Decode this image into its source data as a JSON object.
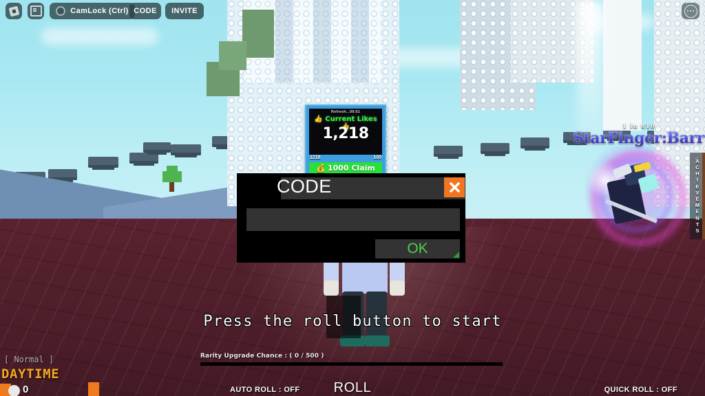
{
  "topbar": {
    "roblox_icon": "roblox-logo-icon",
    "chat_icon": "chat-icon",
    "camlock_label": "CamLock (Ctrl)",
    "code_label": "CODE",
    "invite_label": "INVITE",
    "more_icon": "more-options-icon"
  },
  "likes_board": {
    "refresh_label": "Refresh...09:51",
    "title": "Current Likes",
    "thumbs_icon": "thumbs-up-icon",
    "count": "1,218",
    "progress_min": "1218",
    "progress_max": "100",
    "claim_label": "1000 Claim",
    "claim_icon": "money-bag-icon",
    "claim_color": "#28df3b"
  },
  "aura_unit": {
    "rarity": "1 in 810",
    "name": "StarFinger:Barrage",
    "aura_color": "#e846dc"
  },
  "achievements_tab": {
    "label": "ACHIEVEMENTS",
    "letters": [
      "A",
      "C",
      "H",
      "I",
      "E",
      "V",
      "E",
      "M",
      "E",
      "N",
      "T",
      "S"
    ],
    "accent_color": "#f07a1e"
  },
  "code_dialog": {
    "title": "CODE",
    "close_icon": "close-x-icon",
    "close_color": "#f07621",
    "input_value": "",
    "input_placeholder": "",
    "ok_label": "OK",
    "ok_text_color": "#4ad24a"
  },
  "hud": {
    "press_hint": "Press the roll button to start",
    "rarity_upgrade": "Rarity Upgrade Chance : ( 0 / 500 )",
    "rarity_progress_percent": 0,
    "auto_roll": "AUTO ROLL : OFF",
    "roll_label": "ROLL",
    "quick_roll": "QUICK ROLL : OFF",
    "mode": "[ Normal ]",
    "time_of_day": "DAYTIME",
    "time_color": "#f5a623",
    "currency_count": "0",
    "currency_icon": "coin-icon"
  }
}
